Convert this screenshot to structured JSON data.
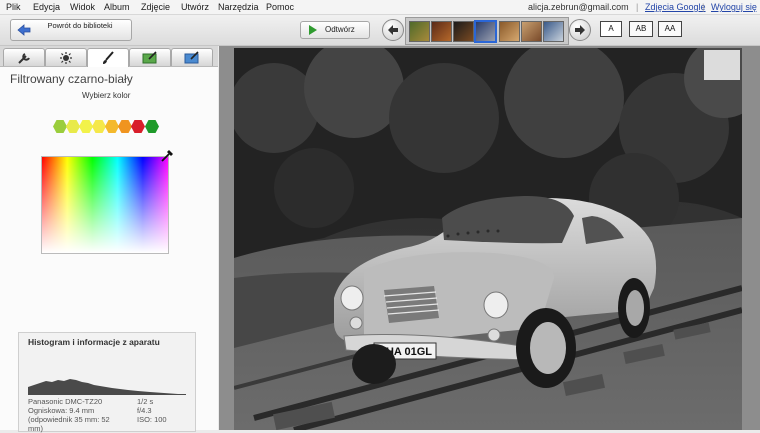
{
  "menu": {
    "items": [
      "Plik",
      "Edycja",
      "Widok",
      "Album",
      "Zdjęcie",
      "Utwórz",
      "Narzędzia",
      "Pomoc"
    ],
    "account_email": "alicja.zebrun@gmail.com",
    "separator": "|",
    "google_photos": "Zdjęcia Google",
    "logout": "Wyloguj się"
  },
  "toolbar": {
    "back_label": "Powrót do biblioteki",
    "play_label": "Odtwórz",
    "size_buttons": [
      "A",
      "AB",
      "AA"
    ]
  },
  "panel": {
    "title": "Filtrowany czarno-biały",
    "pick_color": "Wybierz kolor",
    "swatches": [
      "#9acd3c",
      "#e8ea4a",
      "#f2f24a",
      "#f5e84a",
      "#f4b92c",
      "#f0941f",
      "#d81e2a",
      "#1f9a2a"
    ]
  },
  "histogram": {
    "title": "Histogram i informacje z aparatu",
    "camera": "Panasonic DMC-TZ20",
    "focal": "Ogniskowa: 9.4 mm",
    "equiv": "(odpowiednik 35 mm:  52 mm)",
    "shutter": "1/2 s",
    "aperture": "f/4.3",
    "iso": "ISO: 100"
  },
  "photo": {
    "plate": "BHA 01GL"
  }
}
